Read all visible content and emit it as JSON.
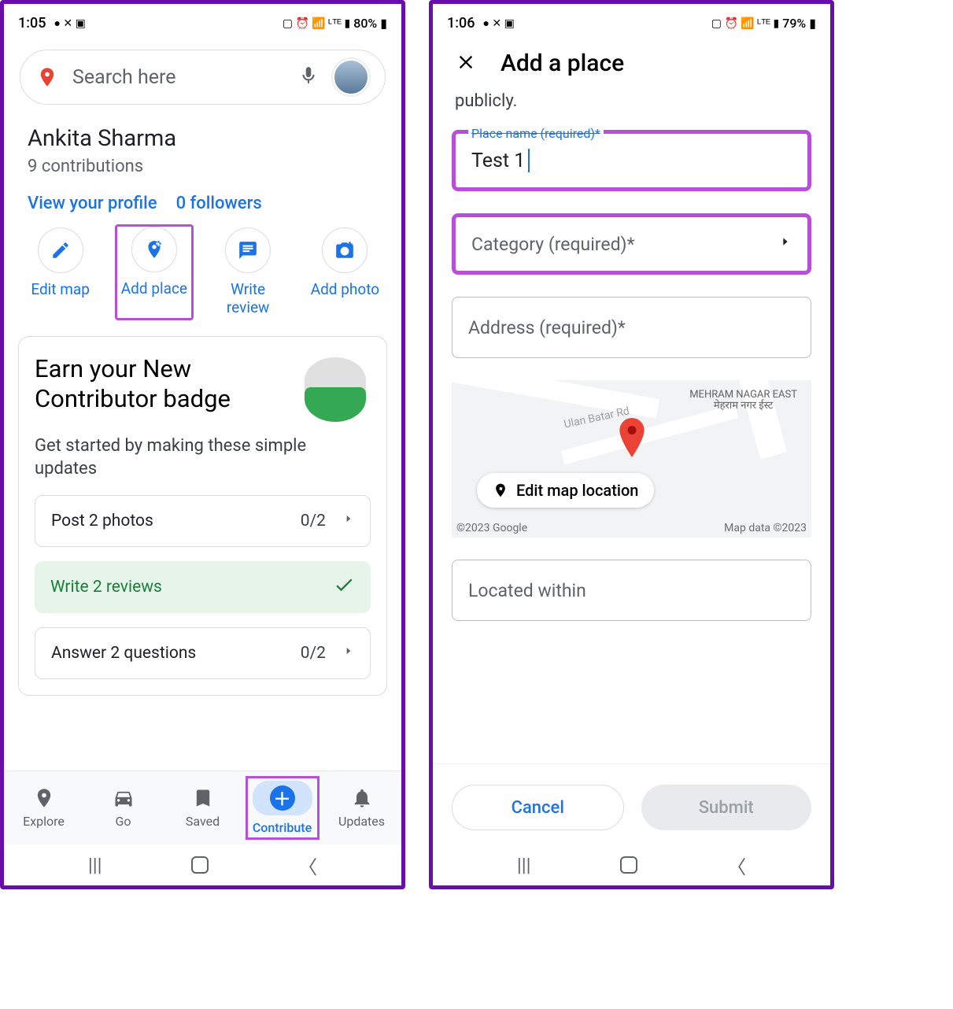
{
  "screen1": {
    "status": {
      "time": "1:05",
      "battery": "80%",
      "icons": "◙ ✕ ▣   ⏰ 📶 LTE ▮"
    },
    "search_placeholder": "Search here",
    "profile": {
      "name": "Ankita Sharma",
      "contrib": "9 contributions",
      "view_link": "View your profile",
      "followers": "0 followers"
    },
    "actions": {
      "edit_map": "Edit map",
      "add_place": "Add place",
      "write_review": "Write review",
      "add_photo": "Add photo"
    },
    "badge": {
      "title": "Earn your New Contributor badge",
      "sub": "Get started by making these simple updates",
      "task1": "Post 2 photos",
      "task1_count": "0/2",
      "task2": "Write 2 reviews",
      "task3": "Answer 2 questions",
      "task3_count": "0/2"
    },
    "nav": {
      "explore": "Explore",
      "go": "Go",
      "saved": "Saved",
      "contribute": "Contribute",
      "updates": "Updates"
    }
  },
  "screen2": {
    "status": {
      "time": "1:06",
      "battery": "79%",
      "icons": "◙ ✕ ▣   ⏰ 📶 LTE ▮"
    },
    "title": "Add a place",
    "publicly": "publicly.",
    "place_name_label": "Place name (required)*",
    "place_name_value": "Test 1",
    "category": "Category (required)*",
    "address": "Address (required)*",
    "map": {
      "street1": "Ulan Batar Rd",
      "area": "MEHRAM NAGAR EAST",
      "area_hi": "मेहराम नगर ईस्ट",
      "edit": "Edit map location",
      "cred_l": "©2023 Google",
      "cred_r": "Map data ©2023"
    },
    "located": "Located within",
    "cancel": "Cancel",
    "submit": "Submit"
  }
}
